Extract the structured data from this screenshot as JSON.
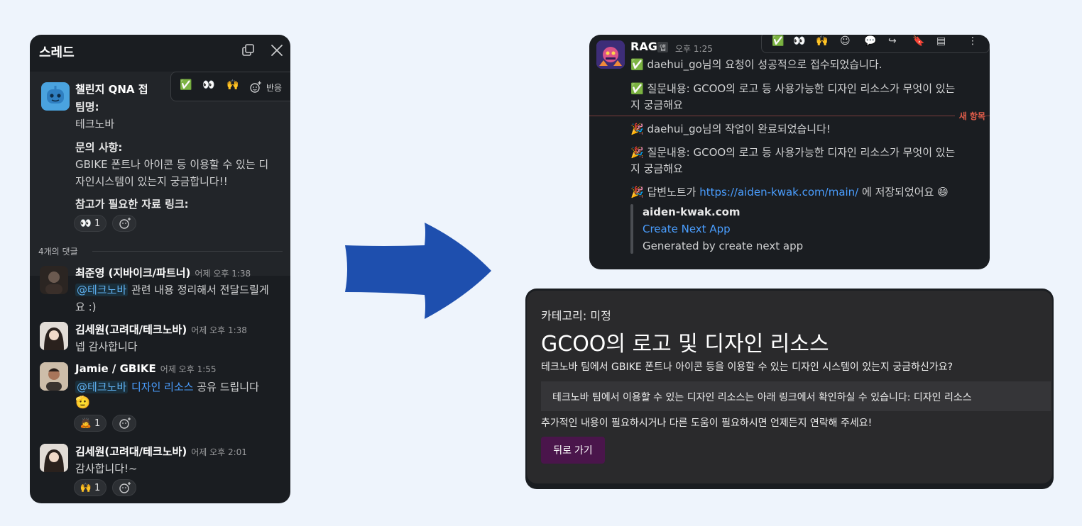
{
  "thread": {
    "title": "스레드",
    "parent": {
      "name": "챌린지 QNA 접",
      "team_label": "팀명:",
      "team_value": "테크노바",
      "inquiry_label": "문의 사항:",
      "inquiry_line1": "GBIKE 폰트나 아이콘 등 이용할 수 있는 디",
      "inquiry_line2": "자인시스템이 있는지 궁금합니다!!",
      "ref_label": "참고가 필요한 자료 링크:",
      "reaction": "👀 1"
    },
    "toolbar": {
      "react_label": "반응"
    },
    "reply_count": "4개의 댓글",
    "replies": [
      {
        "name": "최준영 (지바이크/파트너)",
        "time": "어제 오후 1:38",
        "mention": "@테크노바",
        "text1": " 관련 내용 정리해서 전달드릴게",
        "text2": "요 :)"
      },
      {
        "name": "김세원(고려대/테크노바)",
        "time": "어제 오후 1:38",
        "text1": "넵 감사합니다"
      },
      {
        "name": "Jamie / GBIKE",
        "time": "어제 오후 1:55",
        "mention": "@테크노바",
        "link": "디자인 리소스",
        "text1": " 공유 드립니다",
        "emoji": "🫡",
        "reaction": "🙇 1"
      },
      {
        "name": "김세원(고려대/테크노바)",
        "time": "어제 오후 2:01",
        "text1": "감사합니다!~",
        "reaction": "🙌 1"
      }
    ]
  },
  "rag": {
    "name": "RAG",
    "app_badge": "앱",
    "time": "오후 1:25",
    "lines": [
      "✅ daehui_go님의 요청이 성공적으로 접수되었습니다.",
      "✅ 질문내용: GCOO의 로고 등 사용가능한 디자인 리소스가 무엇이 있는",
      "지 궁금해요",
      "🎉 daehui_go님의 작업이 완료되었습니다!",
      "🎉 질문내용: GCOO의 로고 등 사용가능한 디자인 리소스가 무엇이 있는",
      "지 궁금해요"
    ],
    "note_prefix": "🎉 답변노트가 ",
    "note_link": "https://aiden-kwak.com/main/",
    "note_suffix": " 에 저장되었어요 😄",
    "new_label": "새 항목",
    "unfurl": {
      "site": "aiden-kwak.com",
      "title": "Create Next App",
      "desc": "Generated by create next app"
    }
  },
  "answer": {
    "category": "카테고리: 미정",
    "title": "GCOO의 로고 및 디자인 리소스",
    "question": "테크노바 팀에서 GBIKE 폰트나 아이콘 등을 이용할 수 있는 디자인 시스템이 있는지 궁금하신가요?",
    "quote": "테크노바 팀에서 이용할 수 있는 디자인 리소스는 아래 링크에서 확인하실 수 있습니다: 디자인 리소스",
    "followup": "추가적인 내용이 필요하시거나 다른 도움이 필요하시면 언제든지 연락해 주세요!",
    "back_button": "뒤로 가기"
  },
  "colors": {
    "background": "#eef4fc",
    "panel": "#1a1d21",
    "arrow": "#1e4fae",
    "button": "#4a154b",
    "link": "#4a9eff"
  }
}
